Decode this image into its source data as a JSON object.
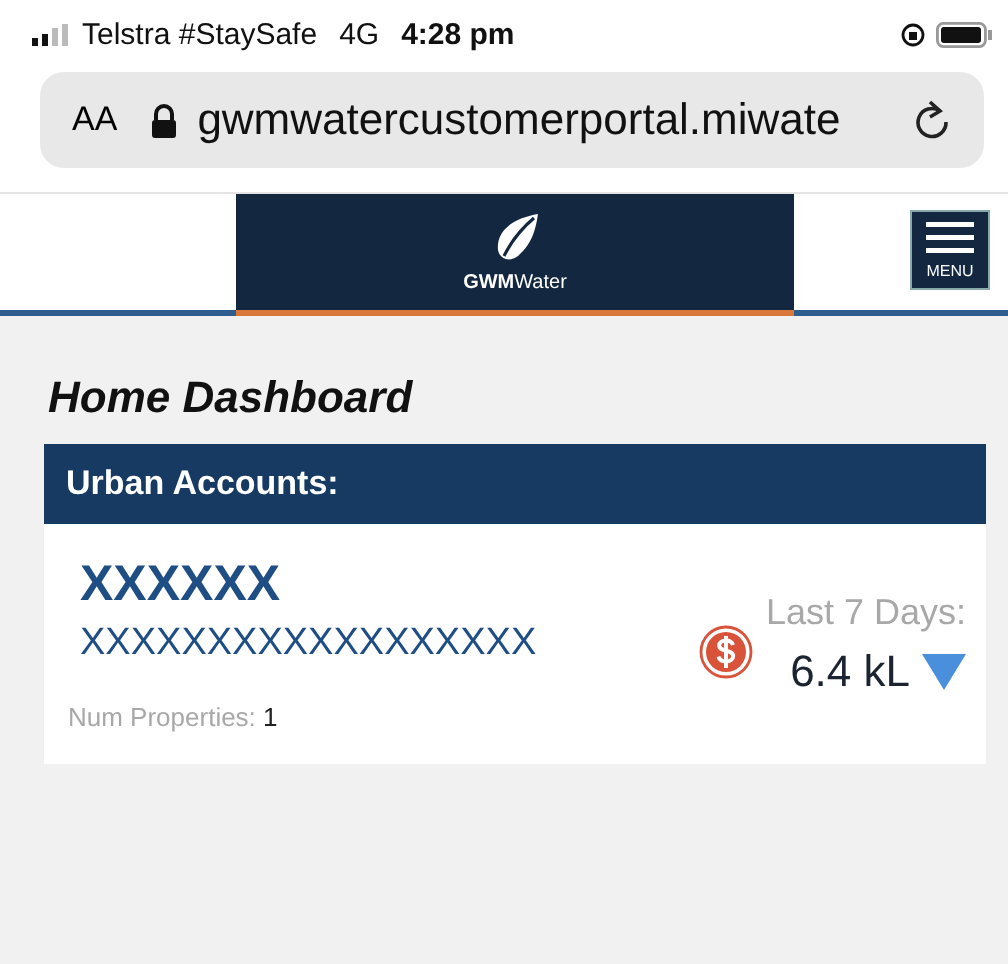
{
  "status_bar": {
    "carrier": "Telstra #StaySafe",
    "network": "4G",
    "time": "4:28 pm"
  },
  "browser": {
    "text_size": "AA",
    "url": "gwmwatercustomerportal.miwate"
  },
  "header": {
    "logo_text": "**GWM**Water",
    "menu_label": "MENU"
  },
  "page": {
    "title": "Home Dashboard",
    "section": "Urban Accounts:"
  },
  "account": {
    "name": "XXXXXX",
    "number": "XXXXXXXXXXXXXXXXXX",
    "period_label": "Last 7 Days:",
    "usage": "6.4 kL",
    "usage_decreased": true,
    "properties_label": "Num Properties:",
    "properties_count": "1"
  }
}
